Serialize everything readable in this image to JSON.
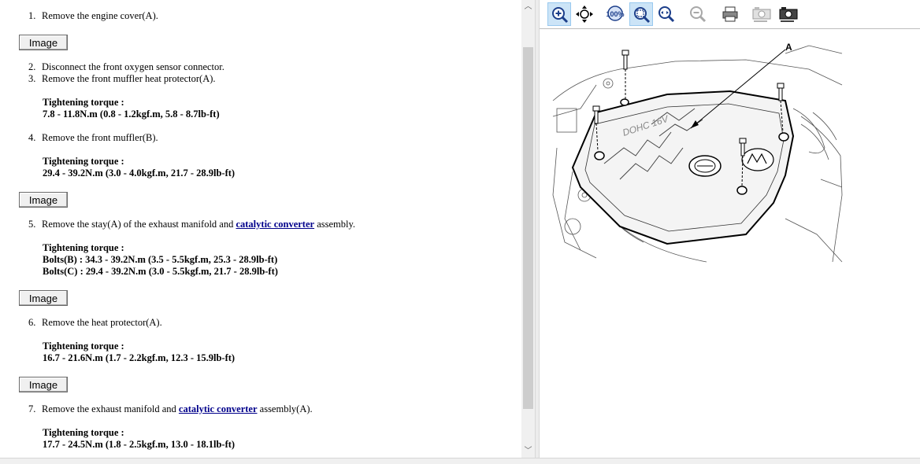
{
  "steps": [
    {
      "num": "1.",
      "text": "Remove the engine cover(A)."
    },
    {
      "num": "2.",
      "text": "Disconnect the front oxygen sensor connector."
    },
    {
      "num": "3.",
      "text": "Remove the front muffler heat protector(A)."
    },
    {
      "num": "4.",
      "text": "Remove the front muffler(B)."
    },
    {
      "num": "5.",
      "text_before": "Remove the stay(A) of the exhaust manifold and ",
      "link": "catalytic converter",
      "text_after": " assembly."
    },
    {
      "num": "6.",
      "text": "Remove the heat protector(A)."
    },
    {
      "num": "7.",
      "text_before": "Remove the exhaust manifold and ",
      "link": "catalytic converter",
      "text_after": " assembly(A)."
    }
  ],
  "image_button_label": "Image",
  "torque": {
    "heading": "Tightening torque :",
    "t3": "7.8 - 11.8N.m (0.8 - 1.2kgf.m, 5.8 - 8.7lb-ft)",
    "t4": "29.4 - 39.2N.m (3.0 - 4.0kgf.m, 21.7 - 28.9lb-ft)",
    "t5a": "Bolts(B) : 34.3 - 39.2N.m (3.5 - 5.5kgf.m, 25.3 - 28.9lb-ft)",
    "t5b": "Bolts(C) : 29.4 - 39.2N.m (3.0 - 5.5kgf.m, 21.7 - 28.9lb-ft)",
    "t6": "16.7 - 21.6N.m (1.7 - 2.2kgf.m, 12.3 - 15.9lb-ft)",
    "t7": "17.7 - 24.5N.m (1.8 - 2.5kgf.m, 13.0 - 18.1lb-ft)"
  },
  "toolbar": {
    "buttons": [
      "zoom-in",
      "pan",
      "zoom-100",
      "zoom-fit",
      "zoom-width",
      "zoom-out",
      "print",
      "copy",
      "save"
    ],
    "labels": {
      "zoom100": "100%"
    }
  },
  "diagram": {
    "callout": "A",
    "engine_text": "DOHC 16V"
  },
  "colors": {
    "link": "#00008b",
    "active_tool": "#cce4f7"
  }
}
